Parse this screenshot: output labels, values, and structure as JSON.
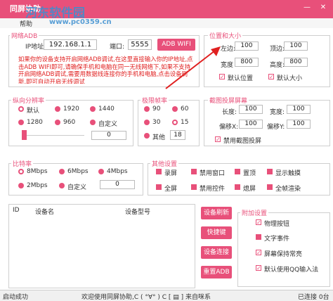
{
  "window": {
    "title": "同屏协助",
    "minimize": "—",
    "close": "✕",
    "menu": "帮助"
  },
  "watermark": {
    "line1": "河东软件园",
    "line2": "www.pc0359.cn"
  },
  "adb": {
    "title": "网络ADB",
    "ip_label": "IP地址:",
    "ip_value": "192.168.1.1",
    "port_label": "端口:",
    "port_value": "5555",
    "wifi_button": "ADB WIFI",
    "note": "如果你的设备支持开启网络ADB调试,在这里直接输入你的IP地址,点击ADB WIFI即可,请确保手机和电脑在同一无线网络下,如果不支持开启网络ADB调试,需要用数据线连接你的手机和电脑,点击设备刷新,即可自动开启无线调试"
  },
  "position": {
    "title": "位置和大小",
    "left_label": "左边:",
    "left_value": "100",
    "top_label": "顶边:",
    "top_value": "100",
    "width_label": "宽度",
    "width_value": "800",
    "height_label": "高度:",
    "height_value": "800",
    "default_pos": "默认位置",
    "default_size": "默认大小"
  },
  "resolution": {
    "title": "纵向分辨率",
    "options": [
      "默认",
      "1920",
      "1440",
      "1280",
      "960",
      "自定义"
    ],
    "slider_value": "0"
  },
  "fps": {
    "title": "极限帧率",
    "options": [
      "90",
      "60",
      "30",
      "15"
    ],
    "other_label": "其他",
    "other_value": "18"
  },
  "crop": {
    "title": "截图投屏屏幕",
    "width_label": "长度:",
    "width_value": "100",
    "height_label": "宽度:",
    "height_value": "100",
    "offx_label": "偏移X:",
    "offx_value": "100",
    "offy_label": "偏移Y:",
    "offy_value": "100",
    "enable": "禁用截图投屏"
  },
  "bitrate": {
    "title": "比特率",
    "options": [
      "8Mbps",
      "6Mbps",
      "4Mbps",
      "2Mbps",
      "自定义"
    ],
    "custom_value": "0"
  },
  "other": {
    "title": "其他设置",
    "options": [
      "录屏",
      "禁用窗口",
      "置顶",
      "显示触摸",
      "全屏",
      "禁用控件",
      "熄屏",
      "全帧渲染"
    ]
  },
  "devices": {
    "columns": [
      "ID",
      "设备名",
      "设备型号"
    ]
  },
  "actions": {
    "refresh": "设备刷新",
    "shortcut": "快捷键",
    "connect": "设备连接",
    "reset": "重置ADB"
  },
  "extra": {
    "title": "附加设置",
    "options": [
      "物理按钮",
      "文字事件",
      "屏幕保持常亮",
      "默认使用QQ输入法"
    ]
  },
  "statusbar": {
    "left": "启动成功",
    "middle": "欢迎使用同屏协助,C ( °∀° ) C [ ▤ ] 来自咪系",
    "right": "已连接 0台"
  }
}
